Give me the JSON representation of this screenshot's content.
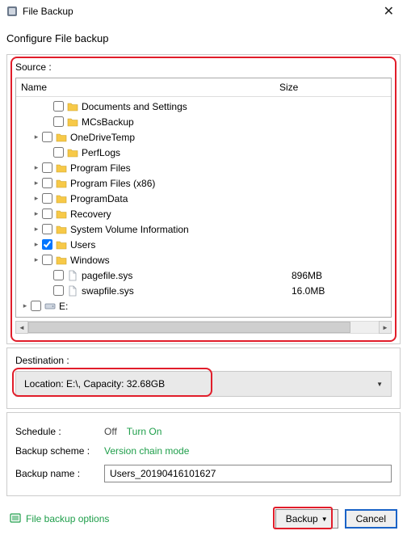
{
  "window": {
    "title": "File Backup"
  },
  "subtitle": "Configure File backup",
  "source": {
    "label": "Source :",
    "columns": {
      "name": "Name",
      "size": "Size"
    },
    "items": [
      {
        "name": "Documents and Settings",
        "type": "folder",
        "checked": false,
        "expander": "",
        "indent": 2,
        "size": ""
      },
      {
        "name": "MCsBackup",
        "type": "folder",
        "checked": false,
        "expander": "",
        "indent": 2,
        "size": ""
      },
      {
        "name": "OneDriveTemp",
        "type": "folder",
        "checked": false,
        "expander": ">",
        "indent": 1,
        "size": ""
      },
      {
        "name": "PerfLogs",
        "type": "folder",
        "checked": false,
        "expander": "",
        "indent": 2,
        "size": ""
      },
      {
        "name": "Program Files",
        "type": "folder",
        "checked": false,
        "expander": ">",
        "indent": 1,
        "size": ""
      },
      {
        "name": "Program Files (x86)",
        "type": "folder",
        "checked": false,
        "expander": ">",
        "indent": 1,
        "size": ""
      },
      {
        "name": "ProgramData",
        "type": "folder",
        "checked": false,
        "expander": ">",
        "indent": 1,
        "size": ""
      },
      {
        "name": "Recovery",
        "type": "folder",
        "checked": false,
        "expander": ">",
        "indent": 1,
        "size": ""
      },
      {
        "name": "System Volume Information",
        "type": "folder",
        "checked": false,
        "expander": ">",
        "indent": 1,
        "size": ""
      },
      {
        "name": "Users",
        "type": "folder",
        "checked": true,
        "expander": ">",
        "indent": 1,
        "size": ""
      },
      {
        "name": "Windows",
        "type": "folder",
        "checked": false,
        "expander": ">",
        "indent": 1,
        "size": ""
      },
      {
        "name": "pagefile.sys",
        "type": "file",
        "checked": false,
        "expander": "",
        "indent": 2,
        "size": "896MB"
      },
      {
        "name": "swapfile.sys",
        "type": "file",
        "checked": false,
        "expander": "",
        "indent": 2,
        "size": "16.0MB"
      },
      {
        "name": "E:",
        "type": "drive",
        "checked": false,
        "expander": ">",
        "indent": 0,
        "size": ""
      }
    ]
  },
  "destination": {
    "label": "Destination :",
    "text": "Location: E:\\, Capacity: 32.68GB"
  },
  "schedule": {
    "label": "Schedule :",
    "state": "Off",
    "action": "Turn On"
  },
  "scheme": {
    "label": "Backup scheme :",
    "value": "Version chain mode"
  },
  "name": {
    "label": "Backup name :",
    "value": "Users_20190416101627"
  },
  "footer": {
    "options": "File backup options",
    "backup": "Backup",
    "cancel": "Cancel"
  }
}
